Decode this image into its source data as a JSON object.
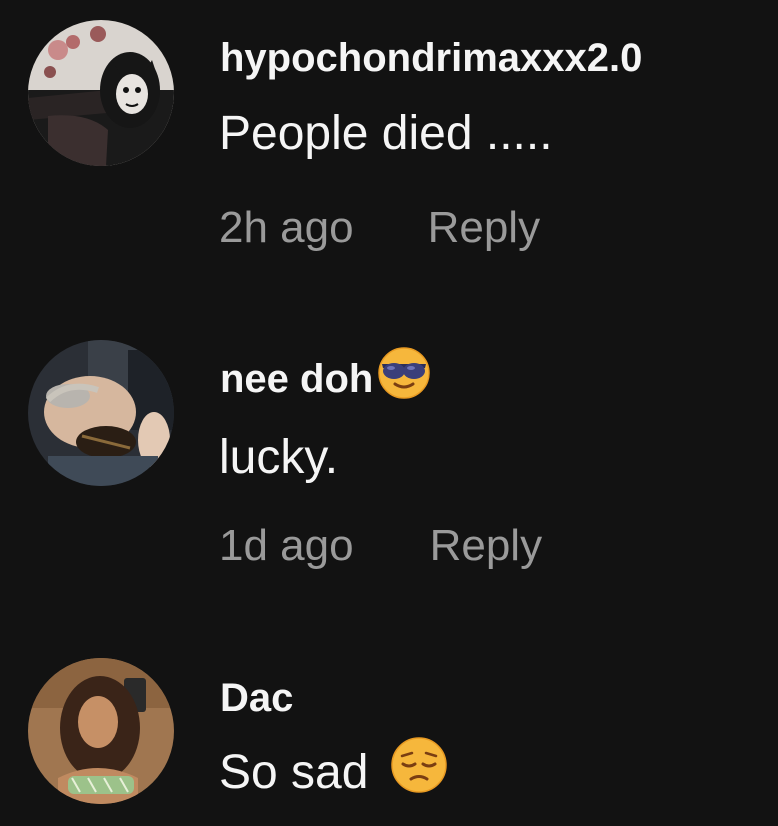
{
  "comments": [
    {
      "username": "hypochondrimaxxx2.0",
      "text": "People died .....",
      "time": "2h ago",
      "reply_label": "Reply",
      "avatar": "profile-photo"
    },
    {
      "username": "nee doh",
      "username_emoji": "smiling-face-with-sunglasses-emoji",
      "text": "lucky.",
      "time": "1d ago",
      "reply_label": "Reply",
      "avatar": "profile-photo"
    },
    {
      "username": "Dac",
      "text": "So sad",
      "text_emoji": "pensive-face-emoji",
      "avatar": "profile-photo"
    }
  ]
}
